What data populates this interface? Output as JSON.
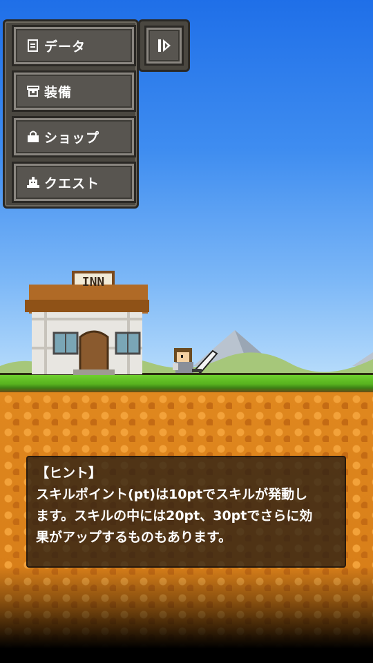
{
  "menu": {
    "items": [
      {
        "label": "データ",
        "icon": "document-icon"
      },
      {
        "label": "装備",
        "icon": "armor-icon"
      },
      {
        "label": "ショップ",
        "icon": "shop-bag-icon"
      },
      {
        "label": "クエスト",
        "icon": "quest-icon"
      }
    ],
    "side_button_icon": "play-bar-icon"
  },
  "scene": {
    "inn_sign": "INN"
  },
  "hint": {
    "title": "【ヒント】",
    "body": "スキルポイント(pt)は10ptでスキルが発動し\nます。スキルの中には20pt、30ptでさらに効\n果がアップするものもあります。"
  },
  "colors": {
    "sky_top": "#1f6fe8",
    "grass": "#6fcf2e",
    "dirt": "#e0881f",
    "panel": "#4a4740"
  }
}
